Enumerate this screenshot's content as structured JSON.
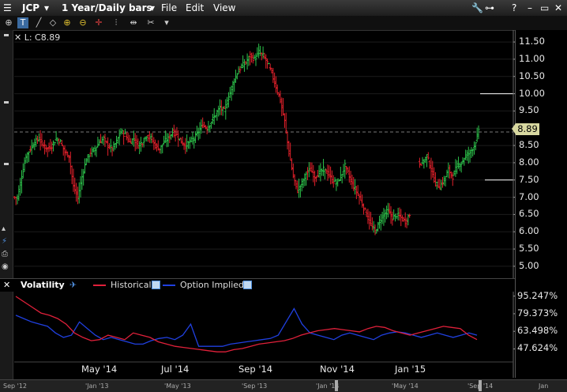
{
  "window": {
    "symbol": "JCP",
    "timeframe": "1 Year/Daily bars",
    "menus": [
      "File",
      "Edit",
      "View"
    ]
  },
  "legend": {
    "text": "L: C8.89"
  },
  "price_badge": "8.89",
  "main_axis": [
    "11.50",
    "11.00",
    "10.50",
    "10.00",
    "9.50",
    "9.00",
    "8.50",
    "8.00",
    "7.50",
    "7.00",
    "6.50",
    "6.00",
    "5.50",
    "5.00"
  ],
  "volatility": {
    "title": "Volatility",
    "historical_label": "Historical",
    "implied_label": "Option Implied",
    "axis": [
      "95.247%",
      "79.373%",
      "63.498%",
      "47.624%"
    ],
    "colors": {
      "historical": "#e0203a",
      "implied": "#2040e0"
    }
  },
  "x_axis": [
    "May '14",
    "Jul '14",
    "Sep '14",
    "Nov '14",
    "Jan '15"
  ],
  "navigator": [
    "Sep '12",
    "'Jan '13",
    "'May '13",
    "'Sep '13",
    "'Jan '14",
    "'May '14",
    "'Sep '14",
    "Jan"
  ],
  "chart_data": {
    "type": "line",
    "price_range": [
      4.7,
      11.8
    ],
    "close_series": [
      7.0,
      7.6,
      8.2,
      8.4,
      8.6,
      8.7,
      8.5,
      8.4,
      8.5,
      8.7,
      8.6,
      8.3,
      8.2,
      7.3,
      7.0,
      7.6,
      8.1,
      8.3,
      8.4,
      8.6,
      8.7,
      8.5,
      8.4,
      8.6,
      8.9,
      8.8,
      8.6,
      8.7,
      8.5,
      8.6,
      8.8,
      8.7,
      8.5,
      8.4,
      8.6,
      8.7,
      8.9,
      8.8,
      8.6,
      8.5,
      8.6,
      8.7,
      8.9,
      9.1,
      9.0,
      9.2,
      9.4,
      9.6,
      9.5,
      9.9,
      10.3,
      10.6,
      10.8,
      10.9,
      11.1,
      11.0,
      11.2,
      11.1,
      10.9,
      10.6,
      10.2,
      9.8,
      9.2,
      8.3,
      7.6,
      7.2,
      7.4,
      7.7,
      7.8,
      7.6,
      7.7,
      7.8,
      7.7,
      7.5,
      7.4,
      7.6,
      7.9,
      7.6,
      7.3,
      7.1,
      6.8,
      6.5,
      6.2,
      6.0,
      6.3,
      6.5,
      6.6,
      6.4,
      6.5,
      6.4,
      6.3,
      6.5,
      null,
      null,
      8.0,
      8.2,
      7.8,
      7.4,
      7.3,
      7.5,
      7.8,
      7.6,
      7.9,
      8.0,
      8.2,
      8.3,
      8.5,
      8.89
    ],
    "historical_vol": [
      95,
      90,
      85,
      80,
      78,
      75,
      70,
      62,
      58,
      55,
      56,
      60,
      58,
      56,
      62,
      60,
      58,
      54,
      52,
      50,
      49,
      48,
      47,
      46,
      45,
      45,
      47,
      48,
      50,
      52,
      53,
      54,
      55,
      57,
      60,
      62,
      64,
      65,
      66,
      65,
      64,
      63,
      66,
      68,
      67,
      64,
      62,
      60,
      62,
      64,
      66,
      68,
      67,
      66,
      60,
      56
    ],
    "implied_vol": [
      78,
      75,
      72,
      70,
      68,
      62,
      58,
      60,
      72,
      66,
      60,
      56,
      58,
      56,
      54,
      52,
      52,
      55,
      57,
      58,
      56,
      60,
      70,
      50,
      50,
      50,
      50,
      52,
      53,
      54,
      55,
      56,
      57,
      60,
      72,
      84,
      70,
      62,
      60,
      58,
      56,
      60,
      62,
      60,
      58,
      56,
      60,
      62,
      63,
      62,
      60,
      58,
      60,
      62,
      60,
      58,
      60,
      62,
      60
    ]
  }
}
